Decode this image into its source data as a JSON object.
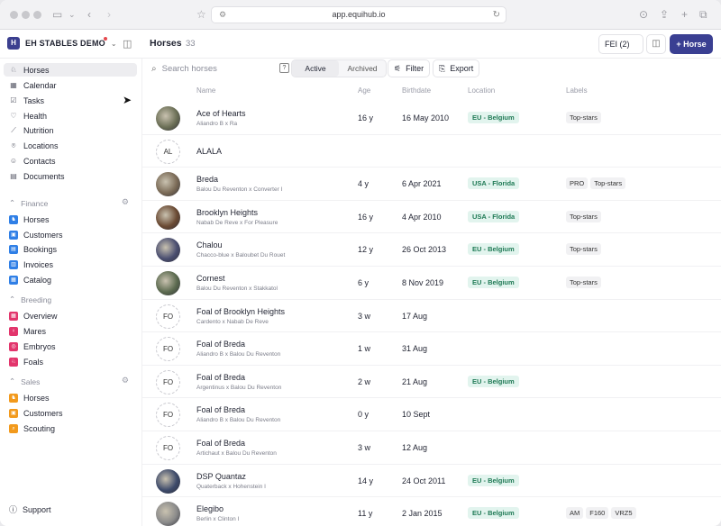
{
  "browser": {
    "url": "app.equihub.io"
  },
  "org": {
    "name": "EH STABLES DEMO",
    "logo_letter": "H"
  },
  "header": {
    "title": "Horses",
    "count": "33",
    "fei_label": "FEI (2)",
    "add_label": "Horse"
  },
  "sidebar": {
    "main_items": [
      "Horses",
      "Calendar",
      "Tasks",
      "Health",
      "Nutrition",
      "Locations",
      "Contacts",
      "Documents"
    ],
    "finance": {
      "label": "Finance",
      "items": [
        "Horses",
        "Customers",
        "Bookings",
        "Invoices",
        "Catalog"
      ],
      "color": "#2f7fe6"
    },
    "breeding": {
      "label": "Breeding",
      "items": [
        "Overview",
        "Mares",
        "Embryos",
        "Foals"
      ],
      "color": "#e2356c"
    },
    "sales": {
      "label": "Sales",
      "items": [
        "Horses",
        "Customers",
        "Scouting"
      ],
      "color": "#f29a1d"
    },
    "support": "Support"
  },
  "toolbar": {
    "search_placeholder": "Search horses",
    "tab_active": "Active",
    "tab_archived": "Archived",
    "filter_label": "Filter",
    "export_label": "Export"
  },
  "table": {
    "columns": [
      "Name",
      "Age",
      "Birthdate",
      "Location",
      "Labels"
    ],
    "rows": [
      {
        "name": "Ace of Hearts",
        "sire": "Aliandro B",
        "dam": "Ra",
        "age": "16 y",
        "birth": "16 May 2010",
        "location": "EU - Belgium",
        "labels": [
          "Top-stars"
        ],
        "initials": "",
        "photo": "#6b6f56"
      },
      {
        "name": "ALALA",
        "sire": "",
        "dam": "",
        "age": "",
        "birth": "",
        "location": "",
        "labels": [],
        "initials": "AL",
        "photo": ""
      },
      {
        "name": "Breda",
        "sire": "Balou Du Reventon",
        "dam": "Converter I",
        "age": "4 y",
        "birth": "6 Apr 2021",
        "location": "USA - Florida",
        "labels": [
          "PRO",
          "Top-stars"
        ],
        "initials": "",
        "photo": "#7a6a56"
      },
      {
        "name": "Brooklyn Heights",
        "sire": "Nabab De Reve",
        "dam": "For Pleasure",
        "age": "16 y",
        "birth": "4 Apr 2010",
        "location": "USA - Florida",
        "labels": [
          "Top-stars"
        ],
        "initials": "",
        "photo": "#6a4a33"
      },
      {
        "name": "Chalou",
        "sire": "Chacco-blue",
        "dam": "Baloubet Du Rouet",
        "age": "12 y",
        "birth": "26 Oct 2013",
        "location": "EU - Belgium",
        "labels": [
          "Top-stars"
        ],
        "initials": "",
        "photo": "#4a4e70"
      },
      {
        "name": "Cornest",
        "sire": "Balou Du Reventon",
        "dam": "Stakkatol",
        "age": "6 y",
        "birth": "8 Nov 2019",
        "location": "EU - Belgium",
        "labels": [
          "Top-stars"
        ],
        "initials": "",
        "photo": "#5b6a4f"
      },
      {
        "name": "Foal of Brooklyn Heights",
        "sire": "Cardento",
        "dam": "Nabab De Reve",
        "age": "3 w",
        "birth": "17 Aug",
        "location": "",
        "labels": [],
        "initials": "FO",
        "photo": ""
      },
      {
        "name": "Foal of Breda",
        "sire": "Aliandro B",
        "dam": "Balou Du Reventon",
        "age": "1 w",
        "birth": "31 Aug",
        "location": "",
        "labels": [],
        "initials": "FO",
        "photo": ""
      },
      {
        "name": "Foal of Breda",
        "sire": "Argentinus",
        "dam": "Balou Du Reventon",
        "age": "2 w",
        "birth": "21 Aug",
        "location": "EU - Belgium",
        "labels": [],
        "initials": "FO",
        "photo": ""
      },
      {
        "name": "Foal of Breda",
        "sire": "Aliandro B",
        "dam": "Balou Du Reventon",
        "age": "0 y",
        "birth": "10 Sept",
        "location": "",
        "labels": [],
        "initials": "FO",
        "photo": ""
      },
      {
        "name": "Foal of Breda",
        "sire": "Artichaut",
        "dam": "Balou Du Reventon",
        "age": "3 w",
        "birth": "12 Aug",
        "location": "",
        "labels": [],
        "initials": "FO",
        "photo": ""
      },
      {
        "name": "DSP Quantaz",
        "sire": "Quaterback",
        "dam": "Hohenstein I",
        "age": "14 y",
        "birth": "24 Oct 2011",
        "location": "EU - Belgium",
        "labels": [],
        "initials": "",
        "photo": "#3d4a6a"
      },
      {
        "name": "Elegibo",
        "sire": "Berlin",
        "dam": "Clinton I",
        "age": "11 y",
        "birth": "2 Jan 2015",
        "location": "EU - Belgium",
        "labels": [
          "AM",
          "F160",
          "VRZ5"
        ],
        "initials": "",
        "photo": "#8a8a8a"
      }
    ]
  }
}
